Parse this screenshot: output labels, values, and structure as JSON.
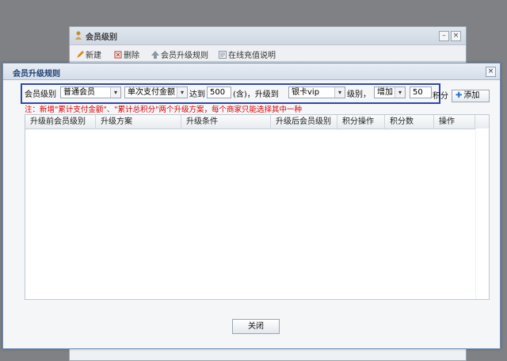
{
  "bg_window": {
    "title": "会员级别",
    "toolbar": [
      {
        "icon": "new-icon",
        "label": "新建"
      },
      {
        "icon": "delete-icon",
        "label": "删除"
      },
      {
        "icon": "upgrade-rule-icon",
        "label": "会员升级规则"
      },
      {
        "icon": "recharge-info-icon",
        "label": "在线充值说明"
      }
    ],
    "minimize": "–",
    "close": "×"
  },
  "dialog": {
    "title": "会员升级规则",
    "close": "×",
    "form": {
      "level_label": "会员级别",
      "level_value": "普通会员",
      "plan_value": "单次支付金额",
      "reach_label": "达到",
      "amount_value": "500",
      "upgrade_to_label": "(含)，升级到",
      "target_level_value": "银卡vip",
      "level_suffix": "级别，",
      "points_op_value": "增加",
      "points_value": "50",
      "points_label": "积分",
      "add_button": "添加"
    },
    "note": "注：新增\"累计支付金额\"、\"累计总积分\"两个升级方案，每个商家只能选择其中一种",
    "table": {
      "columns": [
        "升级前会员级别",
        "升级方案",
        "升级条件",
        "升级后会员级别",
        "积分操作",
        "积分数",
        "操作"
      ],
      "rows": []
    },
    "close_button": "关闭"
  },
  "colors": {
    "dialog_title": "#1f3f72",
    "highlight_border": "#3048a8",
    "note_text": "#e00000"
  }
}
